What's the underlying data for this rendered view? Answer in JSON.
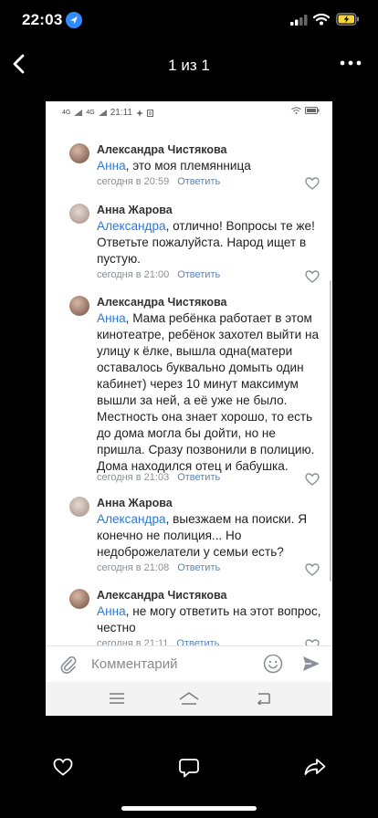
{
  "ios_status": {
    "time": "22:03"
  },
  "viewer": {
    "counter": "1 из 1"
  },
  "photo": {
    "android_status": {
      "time": "21:11",
      "net1": "4G",
      "net2": "4G"
    },
    "comments": [
      {
        "author": "Александра Чистякова",
        "mention": "Анна",
        "text": ", это моя племянница",
        "time": "сегодня в 20:59",
        "reply": "Ответить"
      },
      {
        "author": "Анна Жарова",
        "mention": "Александра",
        "text": ", отлично! Вопросы те же! Ответьте пожалуйста. Народ ищет в пустую.",
        "time": "сегодня в 21:00",
        "reply": "Ответить"
      },
      {
        "author": "Александра Чистякова",
        "mention": "Анна",
        "text": ", Мама ребёнка работает в этом кинотеатре, ребёнок захотел выйти на улицу к ёлке, вышла одна(матери оставалось буквально домыть один кабинет) через 10 минут максимум вышли за ней, а её уже не было. Местность она знает хорошо, то есть до дома могла бы дойти, но не пришла. Сразу позвонили в полицию. Дома находился отец и бабушка.",
        "time": "сегодня в 21:03",
        "reply": "Ответить"
      },
      {
        "author": "Анна Жарова",
        "mention": "Александра",
        "text": ", выезжаем на поиски. Я конечно не полиция... Но недоброжелатели у семьи есть?",
        "time": "сегодня в 21:08",
        "reply": "Ответить"
      },
      {
        "author": "Александра Чистякова",
        "mention": "Анна",
        "text": ", не могу ответить на этот вопрос, честно",
        "time": "сегодня в 21:11",
        "reply": "Ответить"
      }
    ],
    "comment_input": {
      "placeholder": "Комментарий"
    }
  },
  "colors": {
    "mention": "#2a79d8",
    "meta": "#8a8f96",
    "reply": "#5b84b3",
    "accent_ios": "#2f8bff",
    "battery": "#f5d63a"
  },
  "icons": [
    "location-arrow-icon",
    "signal-icon",
    "wifi-icon",
    "battery-icon",
    "back-chevron-icon",
    "more-icon",
    "heart-icon",
    "attach-icon",
    "smile-icon",
    "send-icon",
    "comment-icon",
    "share-icon"
  ]
}
